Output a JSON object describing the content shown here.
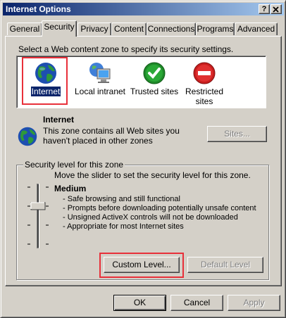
{
  "window": {
    "title": "Internet Options",
    "help_button": "?",
    "close_button": "X"
  },
  "tabs": [
    {
      "label": "General"
    },
    {
      "label": "Security",
      "active": true
    },
    {
      "label": "Privacy"
    },
    {
      "label": "Content"
    },
    {
      "label": "Connections"
    },
    {
      "label": "Programs"
    },
    {
      "label": "Advanced"
    }
  ],
  "security": {
    "instruction": "Select a Web content zone to specify its security settings.",
    "zones": [
      {
        "label": "Internet",
        "icon": "globe-icon",
        "selected": true
      },
      {
        "label": "Local intranet",
        "icon": "intranet-monitor-icon"
      },
      {
        "label": "Trusted sites",
        "icon": "green-check-icon"
      },
      {
        "label": "Restricted sites",
        "label_line1": "Restricted",
        "label_line2": "sites",
        "icon": "red-stop-icon"
      }
    ],
    "selected_zone": {
      "name": "Internet",
      "description_line1": "This zone contains all Web sites you",
      "description_line2": "haven't placed in other zones",
      "sites_button": "Sites..."
    },
    "level_group": {
      "title": "Security level for this zone",
      "instruction": "Move the slider to set the security level for this zone.",
      "level_name": "Medium",
      "bullets": [
        "- Safe browsing and still functional",
        "- Prompts before downloading potentially unsafe content",
        "- Unsigned ActiveX controls will not be downloaded",
        "- Appropriate for most Internet sites"
      ],
      "custom_level_button": "Custom Level...",
      "default_level_button": "Default Level"
    }
  },
  "footer": {
    "ok": "OK",
    "cancel": "Cancel",
    "apply": "Apply"
  },
  "colors": {
    "titlebar_start": "#0a246a",
    "titlebar_end": "#a6caf0",
    "highlight_box": "#e8303a",
    "selection": "#0a246a"
  }
}
